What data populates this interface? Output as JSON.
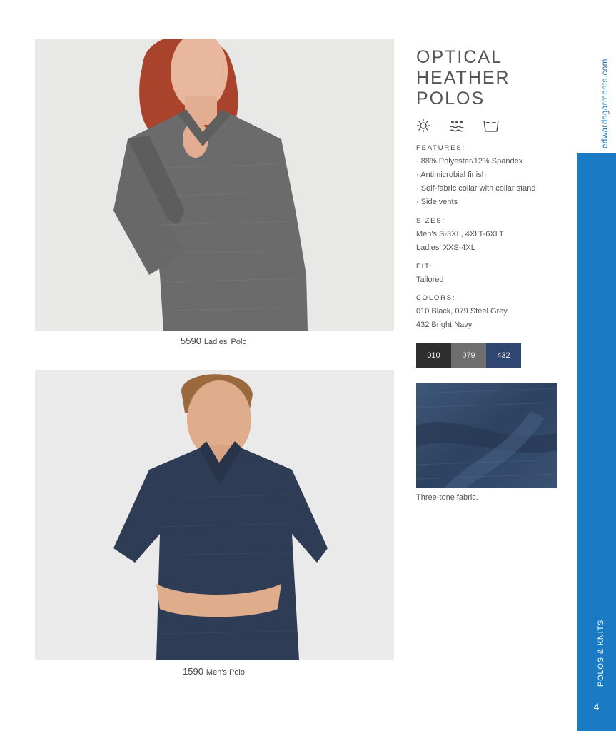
{
  "title": "OPTICAL HEATHER POLOS",
  "care_icons": [
    "sun-icon",
    "wash-icon",
    "tub-icon"
  ],
  "photos": [
    {
      "code": "5590",
      "label": "Ladies' Polo"
    },
    {
      "code": "1590",
      "label": "Men's Polo"
    }
  ],
  "features": {
    "label": "FEATURES:",
    "items": [
      "· 88% Polyester/12% Spandex",
      "· Antimicrobial finish",
      "· Self-fabric collar with collar stand",
      "· Side vents"
    ]
  },
  "sizes": {
    "label": "SIZES:",
    "items": [
      "Men's S-3XL, 4XLT-6XLT",
      "Ladies' XXS-4XL"
    ]
  },
  "fit": {
    "label": "FIT:",
    "items": [
      "Tailored"
    ]
  },
  "colors": {
    "label": "COLORS:",
    "items": [
      "010 Black, 079 Steel Grey,",
      "432 Bright Navy"
    ]
  },
  "swatches": [
    {
      "code": "010",
      "color": "#2e2e2e"
    },
    {
      "code": "079",
      "color": "#6e6e6e"
    },
    {
      "code": "432",
      "color": "#2f4670"
    }
  ],
  "fabric_caption": "Three-tone fabric.",
  "sidebar": {
    "url": "edwardsgarments.com",
    "section": "POLOS & KNITS",
    "page_number": "4",
    "accent_color": "#1a7ac4"
  }
}
